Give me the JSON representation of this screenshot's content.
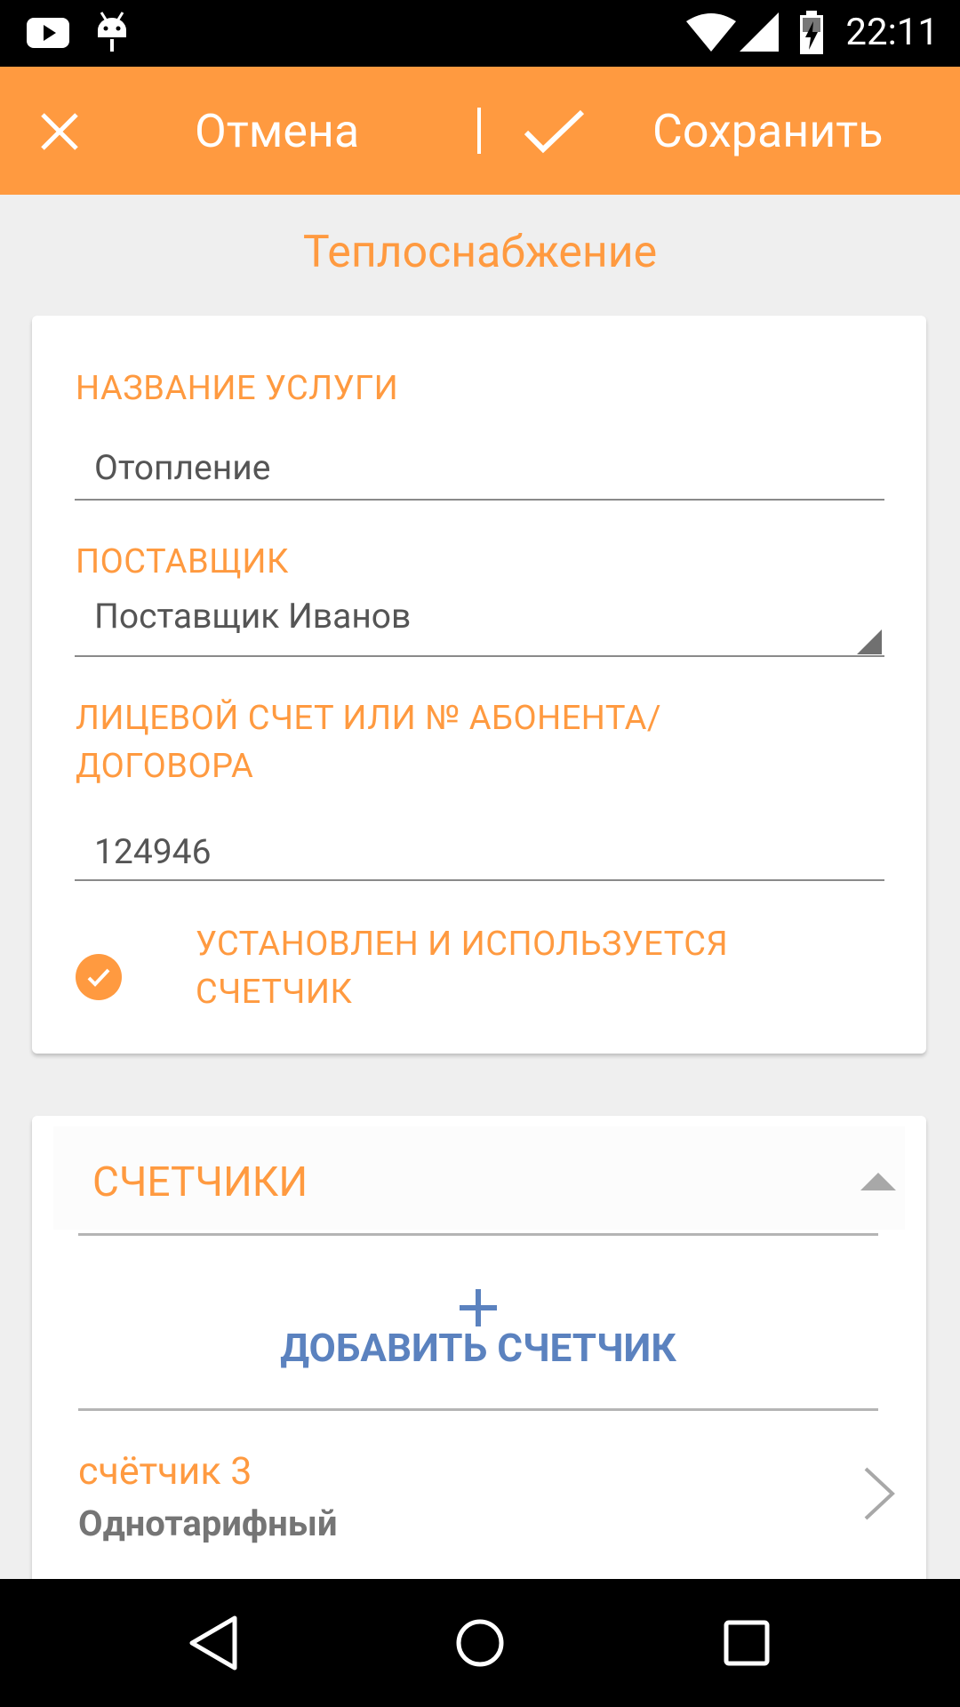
{
  "status_bar": {
    "time": "22:11"
  },
  "toolbar": {
    "cancel_label": "Отмена",
    "save_label": "Сохранить"
  },
  "page": {
    "title": "Теплоснабжение"
  },
  "form": {
    "service_name_label": "НАЗВАНИЕ УСЛУГИ",
    "service_name_value": "Отопление",
    "supplier_label": "ПОСТАВЩИК",
    "supplier_value": "Поставщик Иванов",
    "account_label_line1": "ЛИЦЕВОЙ СЧЕТ ИЛИ № АБОНЕНТА/",
    "account_label_line2": "ДОГОВОРА",
    "account_value": "124946",
    "meter_checkbox_line1": "УСТАНОВЛЕН И ИСПОЛЬЗУЕТСЯ",
    "meter_checkbox_line2": "СЧЕТЧИК",
    "meter_checkbox_checked": true
  },
  "meters": {
    "title": "СЧЕТЧИКИ",
    "add_label": "ДОБАВИТЬ СЧЕТЧИК",
    "items": [
      {
        "name": "счётчик 3",
        "type": "Однотарифный"
      }
    ]
  },
  "colors": {
    "accent": "#ff9a40",
    "link": "#5b82bf"
  },
  "icons": [
    "youtube-icon",
    "android-debug-icon",
    "wifi-icon",
    "signal-icon",
    "battery-charging-icon",
    "close-icon",
    "check-icon",
    "check-circle-icon",
    "collapse-arrow-icon",
    "plus-icon",
    "chevron-right-icon",
    "nav-back-icon",
    "nav-home-icon",
    "nav-recents-icon"
  ]
}
